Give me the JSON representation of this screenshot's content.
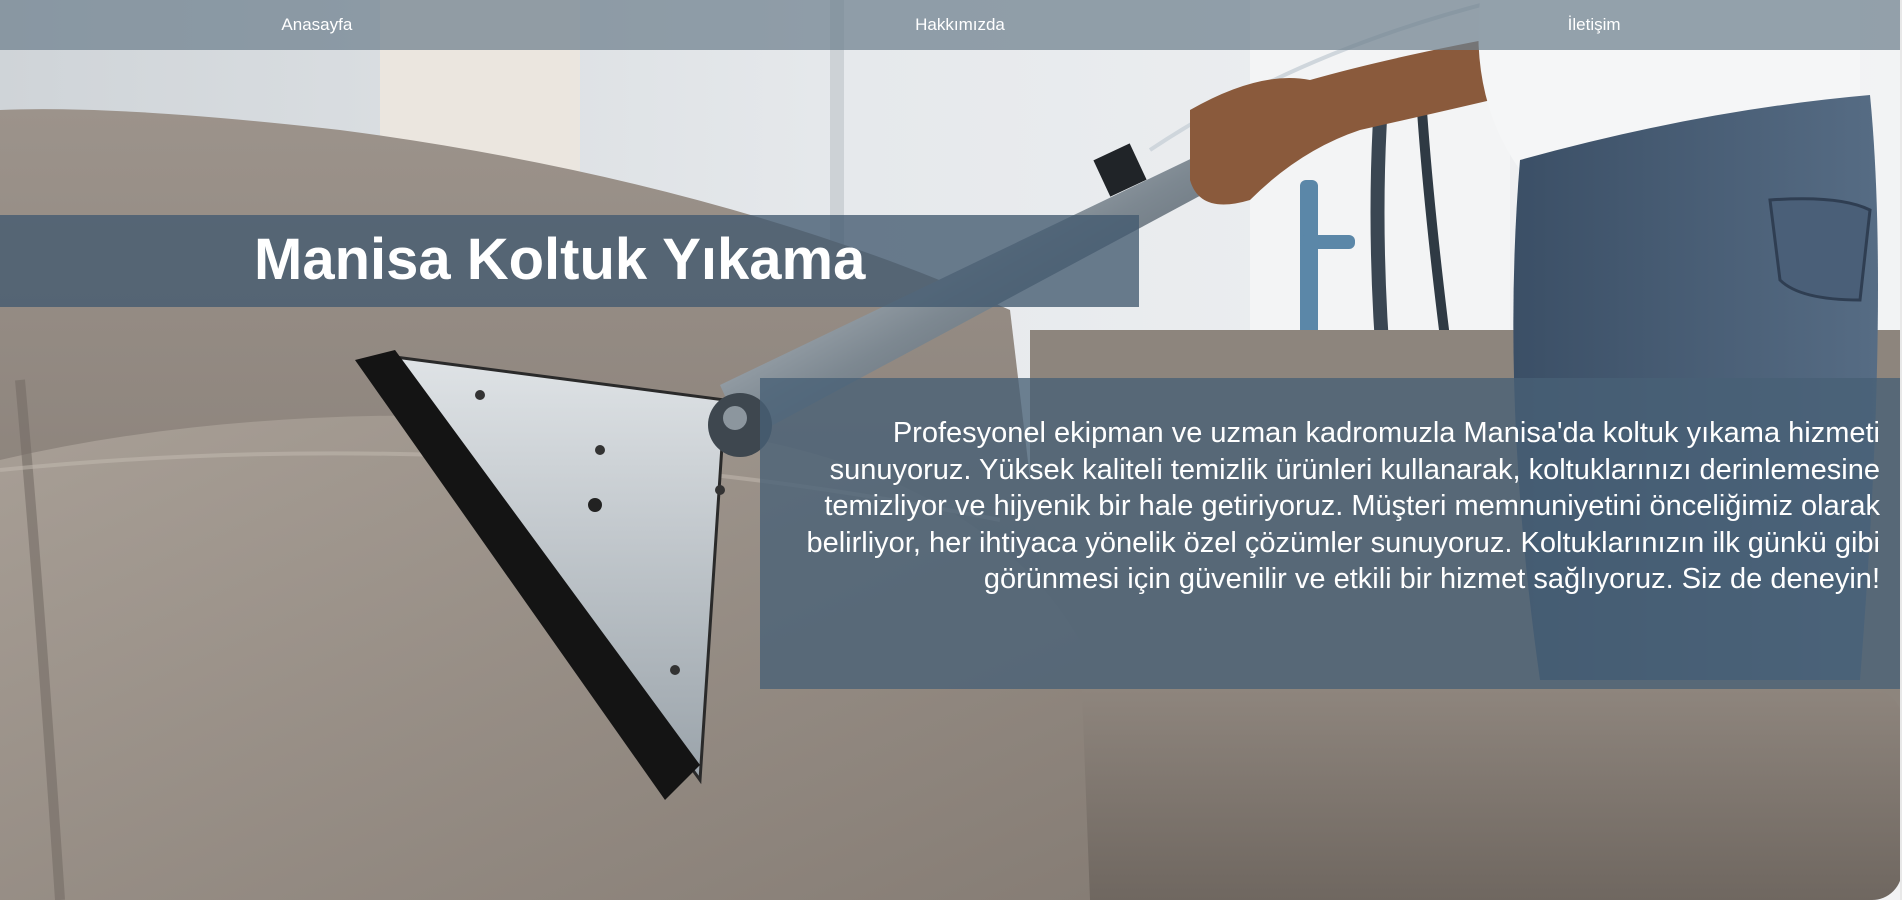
{
  "nav": {
    "items": [
      {
        "label": "Anasayfa"
      },
      {
        "label": "Hakkımızda"
      },
      {
        "label": "İletişim"
      }
    ]
  },
  "hero": {
    "title": "Manisa Koltuk Yıkama",
    "description": "Profesyonel ekipman ve uzman kadromuzla Manisa'da koltuk yıkama hizmeti sunuyoruz. Yüksek kaliteli temizlik ürünleri kullanarak, koltuklarınızı derinlemesine temizliyor ve hijyenik bir hale getiriyoruz. Müşteri memnuniyetini önceliğimiz olarak belirliyor, her ihtiyaca yönelik özel çözümler sunuyoruz. Koltuklarınızın ilk günkü gibi görünmesi için güvenilir ve etkili bir hizmet sağlıyoruz. Siz de deneyin!"
  },
  "colors": {
    "nav_bg": "#6e808e",
    "banner_bg": "#425a70",
    "panel_bg": "#486076",
    "text": "#ffffff"
  }
}
